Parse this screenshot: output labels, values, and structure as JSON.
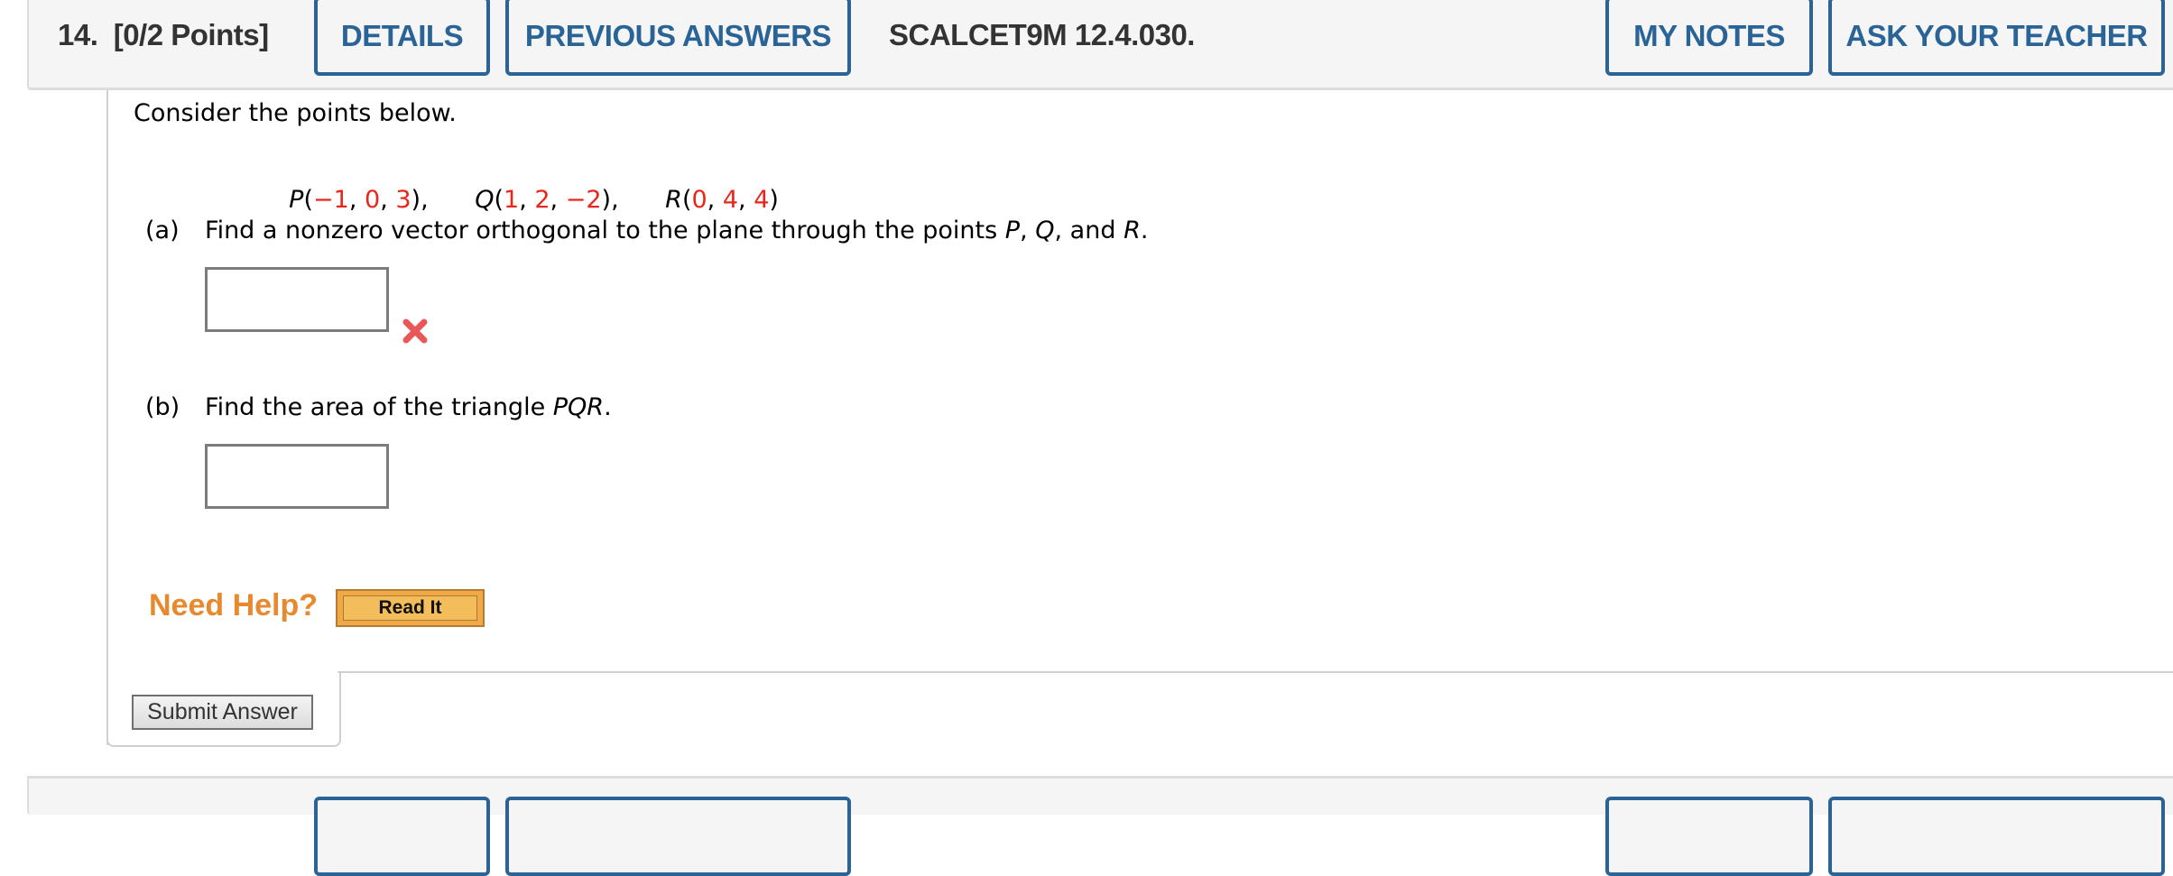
{
  "header": {
    "question_number": "14.",
    "points": "[0/2 Points]",
    "details_label": "DETAILS",
    "previous_answers_label": "PREVIOUS ANSWERS",
    "problem_code": "SCALCET9M 12.4.030.",
    "my_notes_label": "MY NOTES",
    "ask_teacher_label": "ASK YOUR TEACHER"
  },
  "question": {
    "intro": "Consider the points below.",
    "points": [
      {
        "name": "P",
        "coords": [
          "−1",
          "0",
          "3"
        ],
        "sep": ","
      },
      {
        "name": "Q",
        "coords": [
          "1",
          "2",
          "−2"
        ],
        "sep": ","
      },
      {
        "name": "R",
        "coords": [
          "0",
          "4",
          "4"
        ],
        "sep": ""
      }
    ],
    "parts": [
      {
        "label": "(a)",
        "text_before": "Find a nonzero vector orthogonal to the plane through the points ",
        "vars": [
          "P",
          "Q",
          "R"
        ],
        "answer_value": "",
        "status": "incorrect"
      },
      {
        "label": "(b)",
        "text_before": "Find the area of the triangle ",
        "vars": [
          "PQR"
        ],
        "answer_value": "",
        "status": ""
      }
    ]
  },
  "help": {
    "need_help_label": "Need Help?",
    "read_it_label": "Read It"
  },
  "submit_label": "Submit Answer",
  "colors": {
    "accent": "#2a6496",
    "value_red": "#e8261c",
    "help_orange": "#e8892e",
    "incorrect": "#e85050"
  }
}
